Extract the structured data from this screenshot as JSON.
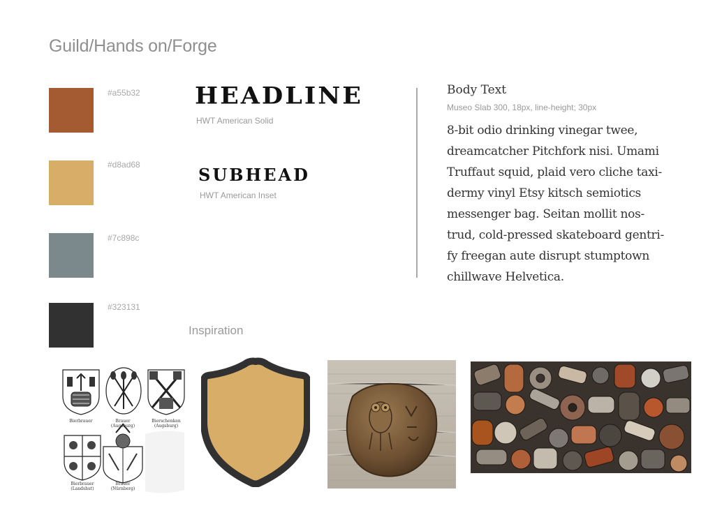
{
  "page": {
    "title": "Guild/Hands on/Forge"
  },
  "palette": [
    {
      "hex": "#a55b32",
      "color": "#a55b32"
    },
    {
      "hex": "#d8ad68",
      "color": "#d8ad68"
    },
    {
      "hex": "#7c898c",
      "color": "#7c898c"
    },
    {
      "hex": "#323131",
      "color": "#323131"
    }
  ],
  "typography": {
    "headline": {
      "sample": "HEADLINE",
      "font": "HWT American Solid"
    },
    "subhead": {
      "sample": "SUBHEAD",
      "font": "HWT American Inset"
    },
    "body": {
      "title": "Body Text",
      "spec": "Museo Slab 300, 18px, line-height; 30px",
      "lines": [
        "8-bit odio drinking vinegar twee,",
        "dreamcatcher Pitchfork nisi. Umami",
        "Truffaut squid, plaid vero cliche taxi-",
        "dermy vinyl Etsy kitsch semiotics",
        "messenger bag. Seitan mollit nos-",
        "trud, cold-pressed skateboard gentri-",
        "fy freegan aute disrupt stumptown",
        "chillwave Helvetica."
      ]
    }
  },
  "inspiration": {
    "heading": "Inspiration",
    "crests": [
      {
        "name": "Bierbrauer",
        "sub": ""
      },
      {
        "name": "Brauer",
        "sub": "(Augsburg)"
      },
      {
        "name": "Bierschenken",
        "sub": "(Augsburg)"
      },
      {
        "name": "Bierbrauer",
        "sub": "(Landshut)"
      },
      {
        "name": "Brauer",
        "sub": "(Nürnberg)"
      }
    ],
    "shield_color": "#d8ad68",
    "shield_outline": "#323131"
  }
}
